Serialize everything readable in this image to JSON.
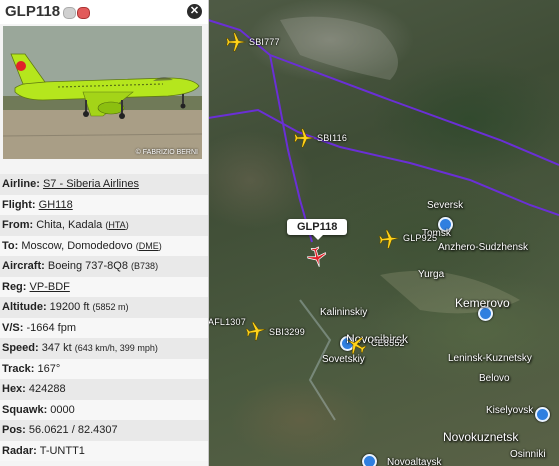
{
  "flight": {
    "callsign": "GLP118",
    "photo_credit": "© FABRIZIO BERNI",
    "close_label": "✕"
  },
  "info": {
    "airline_label": "Airline:",
    "airline_value": "S7 - Siberia Airlines",
    "flight_label": "Flight:",
    "flight_value": "GH118",
    "from_label": "From:",
    "from_city": "Chita, Kadala",
    "from_code": "HTA",
    "to_label": "To:",
    "to_city": "Moscow, Domodedovo",
    "to_code": "DME",
    "aircraft_label": "Aircraft:",
    "aircraft_value": "Boeing 737-8Q8",
    "aircraft_code": "(B738)",
    "reg_label": "Reg:",
    "reg_value": "VP-BDF",
    "altitude_label": "Altitude:",
    "altitude_value": "19200 ft",
    "altitude_metric": "(5852 m)",
    "vs_label": "V/S:",
    "vs_value": "-1664 fpm",
    "speed_label": "Speed:",
    "speed_value": "347 kt",
    "speed_metric": "(643 km/h, 399 mph)",
    "track_label": "Track:",
    "track_value": "167°",
    "hex_label": "Hex:",
    "hex_value": "424288",
    "squawk_label": "Squawk:",
    "squawk_value": "0000",
    "pos_label": "Pos:",
    "pos_value": "56.0621 / 82.4307",
    "radar_label": "Radar:",
    "radar_value": "T-UNTT1"
  },
  "map": {
    "selected_callout": "GLP118",
    "aircraft_labels": {
      "sbi777": "SBI777",
      "sbi116": "SBI116",
      "glp925": "GLP925",
      "afl1307": "AFL1307",
      "sbi3299": "SBI3299",
      "ce8552": "CE8552"
    },
    "cities": {
      "seversk": "Seversk",
      "tomsk": "Tomsk",
      "anzhero": "Anzhero-Sudzhensk",
      "yurga": "Yurga",
      "kemerovo": "Kemerovo",
      "kalininskiy": "Kalininskiy",
      "novosibirsk": "Novosibirsk",
      "sovetskiy": "Sovetskiy",
      "leninsk": "Leninsk-Kuznetsky",
      "belovo": "Belovo",
      "kiselyovsk": "Kiselyovsk",
      "novokuznetsk": "Novokuznetsk",
      "osinniki": "Osinniki",
      "novoaltaysk": "Novoaltaysk"
    },
    "colors": {
      "route": "#6a2fd6",
      "plane": "#ffd21a",
      "selected_plane": "#e0222a"
    }
  }
}
